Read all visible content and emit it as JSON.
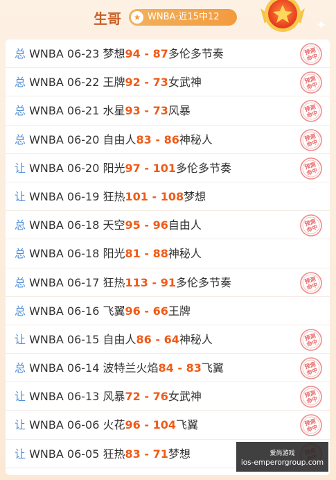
{
  "header": {
    "name": "生哥",
    "badge": "WNBA·近15中12",
    "badge_icon": "star-icon"
  },
  "stamp_text": "预测命中",
  "rows": [
    {
      "type": "总",
      "league": "WNBA",
      "date": "06-23",
      "home": "梦想",
      "score1": "94",
      "score2": "87",
      "away": "多伦多节奏",
      "hit": true
    },
    {
      "type": "总",
      "league": "WNBA",
      "date": "06-22",
      "home": "王牌",
      "score1": "92",
      "score2": "73",
      "away": "女武神",
      "hit": true
    },
    {
      "type": "总",
      "league": "WNBA",
      "date": "06-21",
      "home": "水星",
      "score1": "93",
      "score2": "73",
      "away": "风暴",
      "hit": true
    },
    {
      "type": "总",
      "league": "WNBA",
      "date": "06-20",
      "home": "自由人",
      "score1": "83",
      "score2": "86",
      "away": "神秘人",
      "hit": true
    },
    {
      "type": "让",
      "league": "WNBA",
      "date": "06-20",
      "home": "阳光",
      "score1": "97",
      "score2": "101",
      "away": "多伦多节奏",
      "hit": true
    },
    {
      "type": "让",
      "league": "WNBA",
      "date": "06-19",
      "home": "狂热",
      "score1": "101",
      "score2": "108",
      "away": "梦想",
      "hit": false
    },
    {
      "type": "总",
      "league": "WNBA",
      "date": "06-18",
      "home": "天空",
      "score1": "95",
      "score2": "96",
      "away": "自由人",
      "hit": true
    },
    {
      "type": "总",
      "league": "WNBA",
      "date": "06-18",
      "home": "阳光",
      "score1": "81",
      "score2": "88",
      "away": "神秘人",
      "hit": false
    },
    {
      "type": "总",
      "league": "WNBA",
      "date": "06-17",
      "home": "狂热",
      "score1": "113",
      "score2": "91",
      "away": "多伦多节奏",
      "hit": true
    },
    {
      "type": "总",
      "league": "WNBA",
      "date": "06-16",
      "home": "飞翼",
      "score1": "96",
      "score2": "66",
      "away": "王牌",
      "hit": false
    },
    {
      "type": "让",
      "league": "WNBA",
      "date": "06-15",
      "home": "自由人",
      "score1": "86",
      "score2": "64",
      "away": "神秘人",
      "hit": true
    },
    {
      "type": "总",
      "league": "WNBA",
      "date": "06-14",
      "home": "波特兰火焰",
      "score1": "84",
      "score2": "83",
      "away": "飞翼",
      "hit": true
    },
    {
      "type": "让",
      "league": "WNBA",
      "date": "06-13",
      "home": "风暴",
      "score1": "72",
      "score2": "76",
      "away": "女武神",
      "hit": true
    },
    {
      "type": "让",
      "league": "WNBA",
      "date": "06-06",
      "home": "火花",
      "score1": "96",
      "score2": "104",
      "away": "飞翼",
      "hit": true
    },
    {
      "type": "让",
      "league": "WNBA",
      "date": "06-05",
      "home": "狂热",
      "score1": "83",
      "score2": "71",
      "away": "梦想",
      "hit": true
    }
  ],
  "watermark": {
    "line1": "爱尚游戏",
    "line2": "ios-emperorgroup.com"
  }
}
